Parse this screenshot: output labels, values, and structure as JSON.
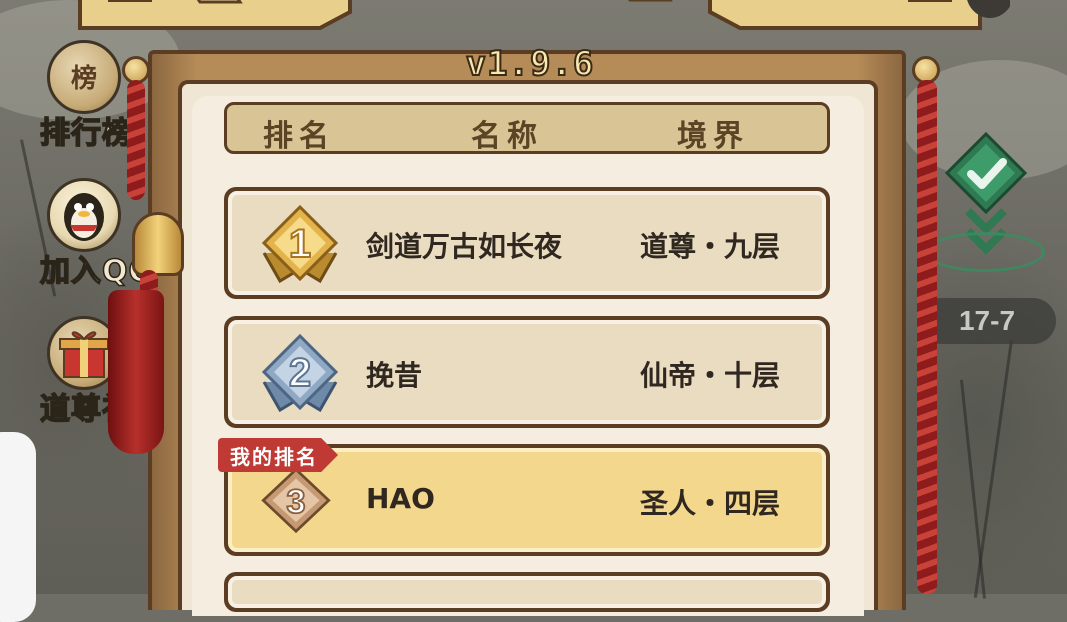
{
  "game": {
    "version": "v1.9.6"
  },
  "side_menu": [
    {
      "label": "排行榜",
      "icon": "trophy-icon"
    },
    {
      "label": "加入QQ群",
      "icon": "penguin-icon"
    },
    {
      "label": "道尊礼包",
      "icon": "gift-box-icon"
    }
  ],
  "right_panel": {
    "level_badge": "17-7",
    "check_icon": "checkmark-diamond-icon"
  },
  "leaderboard": {
    "headers": {
      "rank": "排名",
      "name": "名称",
      "realm": "境界"
    },
    "my_rank_tag": "我的排名",
    "rows": [
      {
        "rank": "1",
        "name": "剑道万古如长夜",
        "realm": "道尊・九层",
        "medal": "gold-medal-icon",
        "mine": false
      },
      {
        "rank": "2",
        "name": "挽昔",
        "realm": "仙帝・十层",
        "medal": "silver-medal-icon",
        "mine": false
      },
      {
        "rank": "3",
        "name": "HAO",
        "realm": "圣人・四层",
        "medal": "bronze-medal-icon",
        "mine": true
      }
    ]
  },
  "colors": {
    "frame_wood": "#b58b58",
    "outline": "#5a3d22",
    "paper": "#efe6d3",
    "row_bg": "#e9dcc0",
    "my_row_bg": "#f2d78c",
    "my_tag": "#c03a35",
    "gold_medal": "#e4b44c",
    "silver_medal": "#8fa8c4",
    "bronze_medal": "#c59a72"
  }
}
